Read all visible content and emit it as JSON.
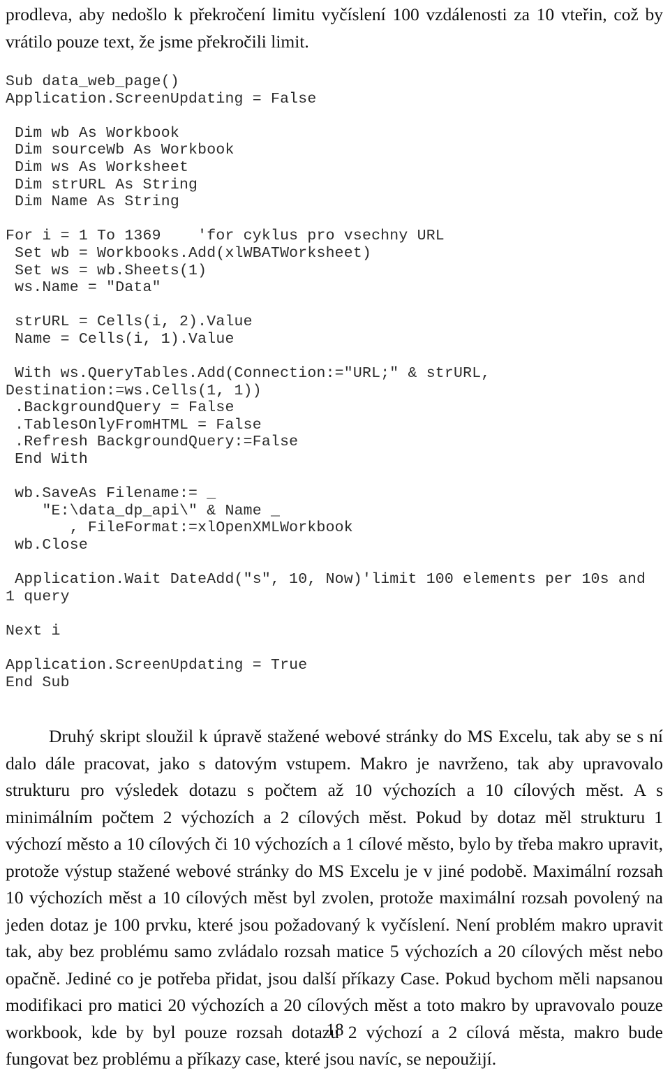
{
  "document": {
    "page_number": "18",
    "language": "cs"
  },
  "intro_paragraph": {
    "text": "prodleva, aby nedošlo k překročení limitu vyčíslení 100 vzdálenosti za 10 vteřin, což by vrátilo pouze text, že jsme překročili limit."
  },
  "code_listing": {
    "language": "VBA",
    "blocks": [
      {
        "id": "block-header",
        "lines": "Sub data_web_page()\nApplication.ScreenUpdating = False"
      },
      {
        "id": "block-declarations",
        "lines": " Dim wb As Workbook\n Dim sourceWb As Workbook\n Dim ws As Worksheet\n Dim strURL As String\n Dim Name As String"
      },
      {
        "id": "block-loop-open",
        "lines": "For i = 1 To 1369    'for cyklus pro vsechny URL\n Set wb = Workbooks.Add(xlWBATWorksheet)\n Set ws = wb.Sheets(1)\n ws.Name = \"Data\""
      },
      {
        "id": "block-cells",
        "lines": " strURL = Cells(i, 2).Value\n Name = Cells(i, 1).Value"
      },
      {
        "id": "block-querytable",
        "lines": " With ws.QueryTables.Add(Connection:=\"URL;\" & strURL, Destination:=ws.Cells(1, 1))\n .BackgroundQuery = False\n .TablesOnlyFromHTML = False\n .Refresh BackgroundQuery:=False\n End With"
      },
      {
        "id": "block-saveas",
        "lines": " wb.SaveAs Filename:= _\n    \"E:\\data_dp_api\\\" & Name _\n       , FileFormat:=xlOpenXMLWorkbook\n wb.Close"
      },
      {
        "id": "block-wait",
        "lines": " Application.Wait DateAdd(\"s\", 10, Now)'limit 100 elements per 10s and 1 query"
      },
      {
        "id": "block-next",
        "lines": "Next i"
      },
      {
        "id": "block-footer",
        "lines": "Application.ScreenUpdating = True\nEnd Sub"
      }
    ]
  },
  "closing_paragraph": {
    "text": "Druhý skript sloužil k úpravě stažené webové stránky do MS Excelu, tak aby se s ní dalo dále pracovat, jako s datovým vstupem. Makro je navrženo, tak aby upravovalo strukturu pro výsledek dotazu s počtem až 10 výchozích a 10 cílových měst.  A s minimálním počtem 2 výchozích a 2 cílových měst. Pokud by dotaz měl strukturu 1 výchozí město a 10 cílových či 10 výchozích a 1 cílové město, bylo by třeba makro upravit, protože výstup stažené webové stránky do MS Excelu je v jiné podobě. Maximální rozsah 10 výchozích měst a 10 cílových měst byl zvolen, protože maximální rozsah povolený na jeden dotaz je 100 prvku, které jsou požadovaný k vyčíslení. Není problém makro upravit tak, aby bez problému samo zvládalo rozsah matice 5 výchozích a 20 cílových měst nebo opačně. Jediné co je potřeba přidat, jsou další příkazy Case. Pokud bychom měli napsanou modifikaci pro matici 20 výchozích a 20 cílových měst a toto makro by upravovalo pouze workbook, kde by byl pouze rozsah dotazu 2 výchozí a 2 cílová města, makro bude fungovat bez problému a příkazy case, které jsou navíc, se nepoužijí."
  }
}
